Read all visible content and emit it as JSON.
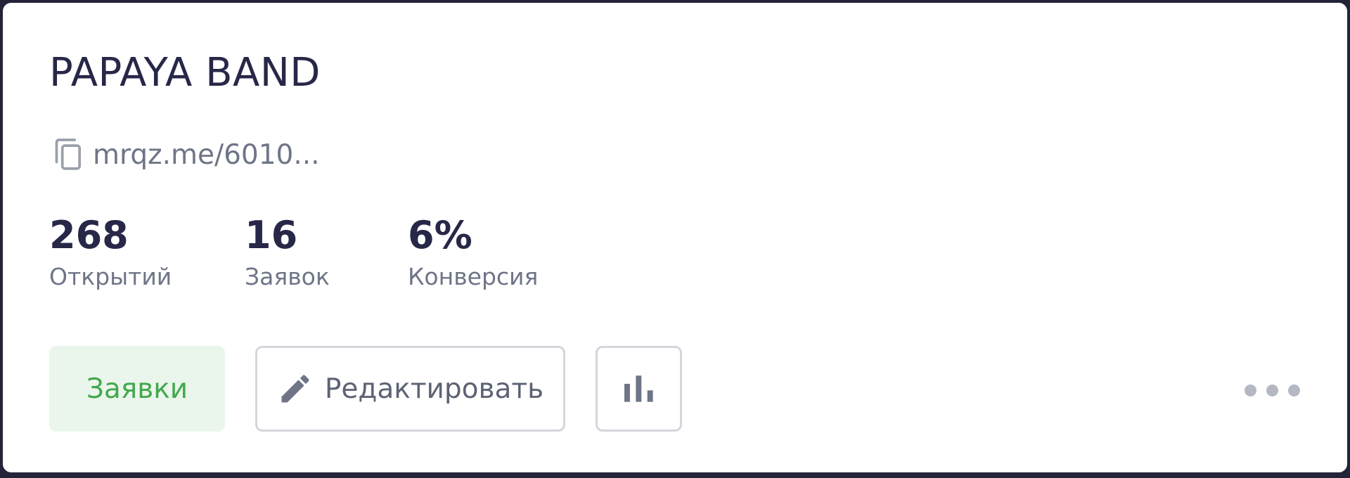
{
  "card": {
    "title": "PAPAYA BAND",
    "link": {
      "text": "mrqz.me/6010...",
      "icon": "copy-icon"
    },
    "stats": [
      {
        "value": "268",
        "label": "Открытий"
      },
      {
        "value": "16",
        "label": "Заявок"
      },
      {
        "value": "6%",
        "label": "Конверсия"
      }
    ],
    "actions": {
      "requests_label": "Заявки",
      "edit_label": "Редактировать",
      "edit_icon": "pencil-icon",
      "stats_icon": "bar-chart-icon",
      "more_icon": "more-dots-icon"
    }
  },
  "colors": {
    "background": "#23233a",
    "card": "#ffffff",
    "title": "#272848",
    "muted_text": "#6e7587",
    "accent_green": "#43a84d",
    "accent_green_bg": "#eaf6ec",
    "border": "#d3d6dc",
    "dots": "#b4b8c2"
  }
}
